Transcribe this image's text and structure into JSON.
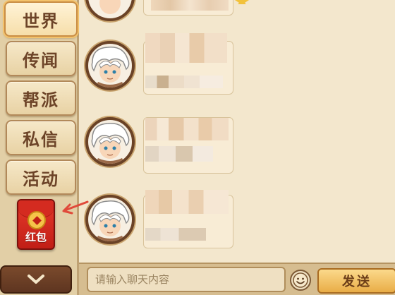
{
  "tabs": [
    {
      "label": "世界",
      "active": true
    },
    {
      "label": "传闻",
      "active": false
    },
    {
      "label": "帮派",
      "active": false
    },
    {
      "label": "私信",
      "active": false
    },
    {
      "label": "活动",
      "active": false
    }
  ],
  "red_packet": {
    "label": "红包"
  },
  "input": {
    "placeholder": "请输入聊天内容"
  },
  "send_label": "发送",
  "icons": {
    "emoji": "smiley-face-icon",
    "collapse": "chevron-down-icon",
    "arrow": "arrow-left-icon",
    "star": "star-icon"
  },
  "colors": {
    "panel": "#e2cfa6",
    "chat_bg": "#f3e7cd",
    "accent": "#e9ad47",
    "red": "#c11e16",
    "arrow": "#e04a3a"
  }
}
